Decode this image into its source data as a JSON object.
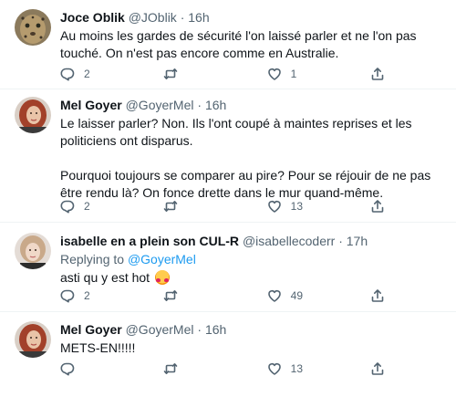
{
  "tweets": [
    {
      "name": "Joce Oblik",
      "handle": "@JOblik",
      "time": "16h",
      "lines": [
        "Au moins les gardes de sécurité l'on laissé parler et ne l'on pas touché. On n'est pas encore comme en Australie."
      ],
      "reply_count": "2",
      "retweet_count": "",
      "like_count": "1",
      "avatar": "leopard"
    },
    {
      "name": "Mel Goyer",
      "handle": "@GoyerMel",
      "time": "16h",
      "lines": [
        "Le laisser parler? Non. Ils l'ont coupé à maintes reprises et les politiciens ont disparus.",
        "Pourquoi toujours se comparer au pire? Pour se réjouir de ne pas être rendu là? On fonce drette dans le mur quand-même."
      ],
      "reply_count": "2",
      "retweet_count": "",
      "like_count": "13",
      "avatar": "woman-redhair"
    },
    {
      "name": "isabelle en a plein son CUL-R",
      "handle": "@isabellecoderr",
      "time": "17h",
      "replying_prefix": "Replying to",
      "replying_handle": "@GoyerMel",
      "text": "asti qu y est hot",
      "emoji": "smiling-face-with-hearts",
      "reply_count": "2",
      "retweet_count": "",
      "like_count": "49",
      "avatar": "woman-blonde"
    },
    {
      "name": "Mel Goyer",
      "handle": "@GoyerMel",
      "time": "16h",
      "text": "METS-EN!!!!!",
      "reply_count": "",
      "retweet_count": "",
      "like_count": "13",
      "avatar": "woman-redhair"
    }
  ],
  "separator": "·",
  "colors": {
    "text": "#0f1419",
    "secondary": "#536471",
    "link": "#1d9bf0",
    "border": "#eff3f4"
  },
  "icons": [
    "reply-icon",
    "retweet-icon",
    "like-icon",
    "share-icon"
  ]
}
